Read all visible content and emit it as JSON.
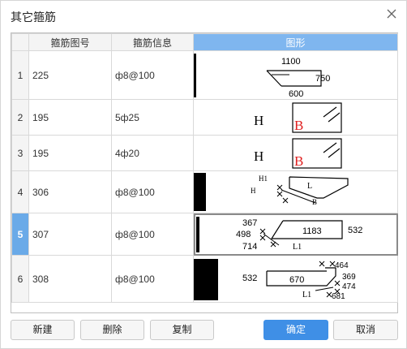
{
  "dialog": {
    "title": "其它箍筋"
  },
  "columns": {
    "row_num": "",
    "code": "箍筋图号",
    "info": "箍筋信息",
    "shape": "图形"
  },
  "rows": [
    {
      "num": "1",
      "code": "225",
      "info": "ф8@100",
      "shape_labels": {
        "a": "1100",
        "b": "750",
        "c": "600"
      }
    },
    {
      "num": "2",
      "code": "195",
      "info": "5ф25",
      "shape_labels": {
        "h": "H",
        "b": "B"
      }
    },
    {
      "num": "3",
      "code": "195",
      "info": "4ф20",
      "shape_labels": {
        "h": "H",
        "b": "B"
      }
    },
    {
      "num": "4",
      "code": "306",
      "info": "ф8@100",
      "shape_labels": {
        "h1": "H1",
        "h": "H",
        "l": "L",
        "b": "B"
      }
    },
    {
      "num": "5",
      "code": "307",
      "info": "ф8@100",
      "shape_labels": {
        "a": "367",
        "b": "498",
        "c": "714",
        "d": "1183",
        "e": "532",
        "l1": "L1"
      }
    },
    {
      "num": "6",
      "code": "308",
      "info": "ф8@100",
      "shape_labels": {
        "a": "532",
        "b": "670",
        "c": "464",
        "d": "369",
        "e": "474",
        "f": "681",
        "l1": "L1"
      }
    }
  ],
  "selected_row": "5",
  "buttons": {
    "new": "新建",
    "delete": "删除",
    "copy": "复制",
    "ok": "确定",
    "cancel": "取消"
  },
  "colors": {
    "accent": "#3f8fe6",
    "header_selected": "#7fb6ef",
    "row_selected": "#6aaae8",
    "label_red": "#e02020"
  }
}
